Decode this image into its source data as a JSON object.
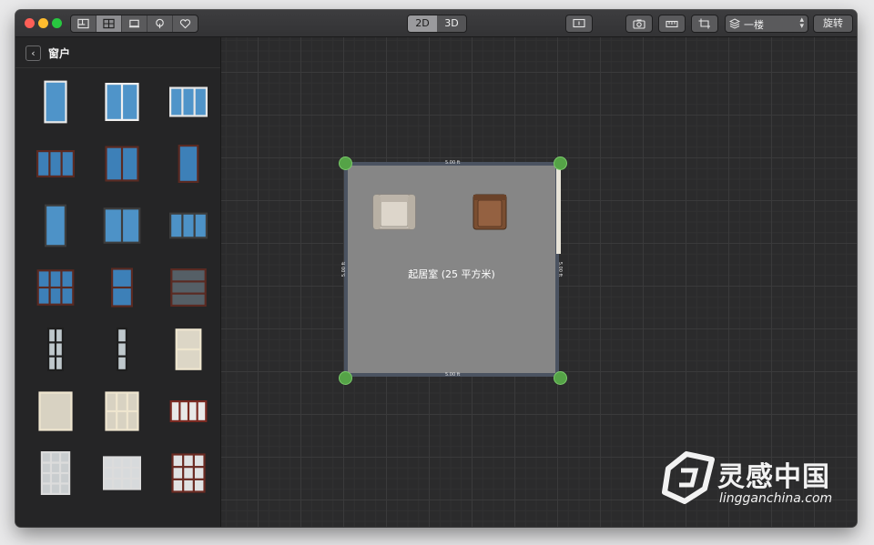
{
  "toolbar": {
    "view_buttons": [
      "floorplan-icon",
      "catalog-grid-icon",
      "furniture-icon",
      "tree-icon",
      "heart-icon"
    ],
    "mode_2d": "2D",
    "mode_3d": "3D",
    "floor_label": "一楼",
    "rotate_label": "旋转",
    "right_icons": [
      "camera-icon",
      "ruler-icon",
      "crop-icon"
    ]
  },
  "sidebar": {
    "title": "窗户",
    "item_count": 21
  },
  "plan": {
    "room_label": "起居室 (25 平方米)",
    "dim_top": "5.00 ft",
    "dim_bottom": "5.00 ft",
    "dim_left": "5.00 ft",
    "dim_right": "5.00 ft"
  },
  "watermark": {
    "text": "灵感中国",
    "sub": "lingganchina.com"
  },
  "colors": {
    "accent_node": "#55a347",
    "wall": "#4b5361",
    "floor": "#868686"
  }
}
